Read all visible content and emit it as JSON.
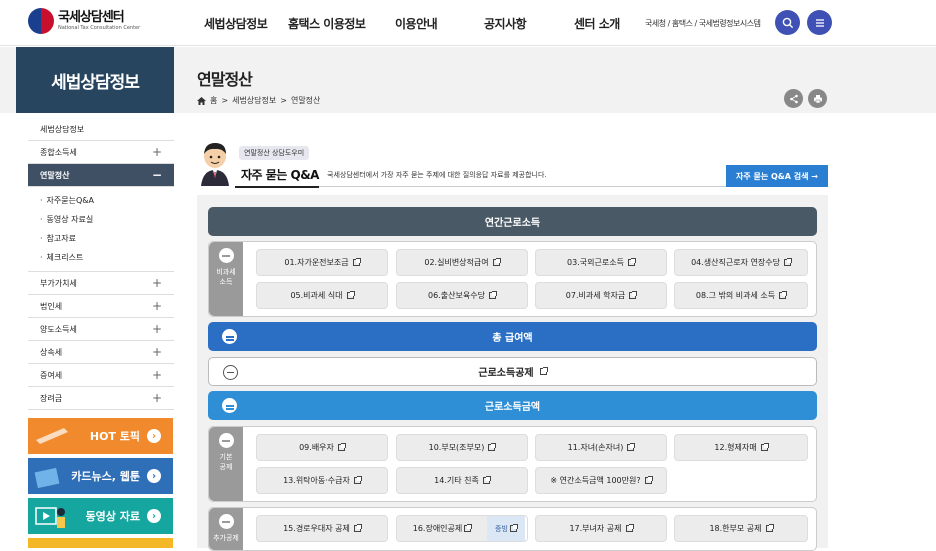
{
  "header": {
    "logo_main": "국세상담센터",
    "logo_sub": "National Tax Consultation Center",
    "nav": [
      "세법상담정보",
      "홈택스 이용정보",
      "이용안내",
      "공지사항",
      "센터 소개"
    ],
    "util": "국세청 / 홈택스 / 국세법령정보시스템",
    "search_icon": "search-icon",
    "menu_icon": "menu-icon"
  },
  "banner": {
    "section_title": "세법상담정보",
    "page_title": "연말정산",
    "breadcrumb": [
      "홈",
      "세법상담정보",
      "연말정산"
    ]
  },
  "sidebar": {
    "items": [
      {
        "label": "세법상담정보",
        "toggle": ""
      },
      {
        "label": "종합소득세",
        "toggle": "+"
      },
      {
        "label": "연말정산",
        "toggle": "−"
      }
    ],
    "sub_items": [
      "자주묻는Q&A",
      "동영상 자료실",
      "참고자료",
      "체크리스트"
    ],
    "items_after": [
      {
        "label": "부가가치세",
        "toggle": "+"
      },
      {
        "label": "법인세",
        "toggle": "+"
      },
      {
        "label": "양도소득세",
        "toggle": "+"
      },
      {
        "label": "상속세",
        "toggle": "+"
      },
      {
        "label": "증여세",
        "toggle": "+"
      },
      {
        "label": "장려금",
        "toggle": "+"
      }
    ],
    "promos": [
      {
        "label": "HOT 토픽",
        "color": "#f08a2c"
      },
      {
        "label": "카드뉴스, 웹툰",
        "color": "#2f6fb7"
      },
      {
        "label": "동영상 자료",
        "color": "#16a6a0"
      }
    ]
  },
  "main": {
    "badge": "연말정산 상담도우미",
    "qa_title": "자주 묻는 Q&A",
    "qa_desc": "국세상담센터에서 가장 자주 묻는 주제에 대한 질의응답 자료를 제공합니다.",
    "search_button": "자주 묻는 Q&A 검색 →",
    "bars": {
      "annual_income": "연간근로소득",
      "total_pay": "총 급여액",
      "deduction": "근로소득공제",
      "income_amount": "근로소득금액"
    },
    "nontax": {
      "label": "비과세 소득",
      "cells": [
        "01.자가운전보조금",
        "02.실비변상적급여",
        "03.국외근로소득",
        "04.생산직근로자 연장수당",
        "05.비과세 식대",
        "06.출산보육수당",
        "07.비과세 학자금",
        "08.그 밖의 비과세 소득"
      ]
    },
    "basic": {
      "label": "기본 공제",
      "cells": [
        "09.배우자",
        "10.부모(조부모)",
        "11.자녀(손자녀)",
        "12.형제자매",
        "13.위탁아동·수급자",
        "14.기타 친족",
        "※ 연간소득금액 100만원?"
      ]
    },
    "additional": {
      "label": "추가공제",
      "cells": [
        "15.경로우대자 공제",
        "16.장애인공제",
        "17.부녀자 공제",
        "18.한부모 공제"
      ],
      "proof": "증빙"
    }
  },
  "colors": {
    "dark_bar": "#4a5966",
    "blue_bar": "#2a6fc4",
    "light_blue_bar": "#2f8fd6"
  }
}
